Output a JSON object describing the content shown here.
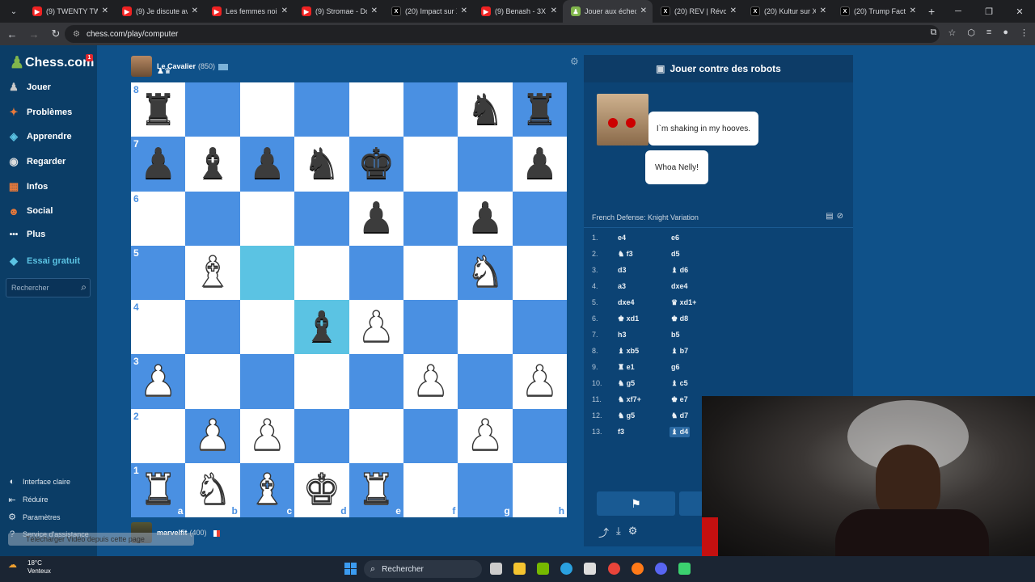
{
  "browser": {
    "tabs": [
      {
        "title": "(9) TWENTY TWE",
        "icon": "youtube-icon"
      },
      {
        "title": "(9) Je discute ave",
        "icon": "youtube-icon"
      },
      {
        "title": "Les femmes noire",
        "icon": "youtube-icon"
      },
      {
        "title": "(9) Stromae - Dou",
        "icon": "youtube-icon"
      },
      {
        "title": "(20) Impact sur X",
        "icon": "x-icon"
      },
      {
        "title": "(9) Benash - 3X D",
        "icon": "youtube-icon"
      },
      {
        "title": "Jouer aux échecs",
        "icon": "chesscom-icon",
        "active": true
      },
      {
        "title": "(20) REV | Révolut",
        "icon": "x-icon"
      },
      {
        "title": "(20) Kultur sur X",
        "icon": "x-icon"
      },
      {
        "title": "(20) Trump Fact N",
        "icon": "x-icon"
      }
    ],
    "url": "chess.com/play/computer"
  },
  "sidebar": {
    "logo": "Chess.com",
    "badge": "1",
    "items": [
      {
        "label": "Jouer",
        "icon": "play-icon"
      },
      {
        "label": "Problèmes",
        "icon": "puzzle-icon"
      },
      {
        "label": "Apprendre",
        "icon": "learn-icon"
      },
      {
        "label": "Regarder",
        "icon": "watch-icon"
      },
      {
        "label": "Infos",
        "icon": "news-icon"
      },
      {
        "label": "Social",
        "icon": "social-icon"
      },
      {
        "label": "Plus",
        "icon": "more-icon"
      },
      {
        "label": "Essai gratuit",
        "icon": "diamond-icon",
        "accent": "#5bc3e3"
      }
    ],
    "search_placeholder": "Rechercher",
    "footer": [
      {
        "label": "Interface claire",
        "icon": "contrast-icon"
      },
      {
        "label": "Réduire",
        "icon": "collapse-icon"
      },
      {
        "label": "Paramètres",
        "icon": "settings-icon"
      },
      {
        "label": "Service d'assistance",
        "icon": "help-icon"
      }
    ]
  },
  "opponent": {
    "name": "Le Cavalier",
    "rating": "(850)"
  },
  "player": {
    "name": "marvelfit",
    "rating": "(400)"
  },
  "download_popup": "Télécharger Vidéo depuis cette page",
  "board": {
    "light_color": "#ffffff",
    "dark_color": "#4a90e2",
    "highlight_color": "#5bc3e3",
    "ranks": [
      "8",
      "7",
      "6",
      "5",
      "4",
      "3",
      "2",
      "1"
    ],
    "files": [
      "a",
      "b",
      "c",
      "d",
      "e",
      "f",
      "g",
      "h"
    ],
    "pieces": {
      "a8": "br",
      "g8": "bn",
      "h8": "br",
      "a7": "bp",
      "b7": "bb",
      "c7": "bp",
      "d7": "bn",
      "e7": "bk",
      "h7": "bp",
      "e6": "bp",
      "g6": "bp",
      "b5": "wb",
      "g5": "wn",
      "d4": "bb",
      "e4": "wp",
      "a3": "wp",
      "f3": "wp",
      "h3": "wp",
      "b2": "wp",
      "c2": "wp",
      "g2": "wp",
      "a1": "wr",
      "b1": "wn",
      "c1": "wb",
      "d1": "wk",
      "e1": "wr"
    },
    "highlights": [
      "c5",
      "d4"
    ]
  },
  "panel": {
    "title": "Jouer contre des robots",
    "bubbles": [
      "I`m shaking in my hooves.",
      "Whoa Nelly!"
    ],
    "opening": "French Defense: Knight Variation",
    "moves": [
      {
        "n": "1.",
        "w": "e4",
        "b": "e6"
      },
      {
        "n": "2.",
        "w": "♞ f3",
        "b": "d5"
      },
      {
        "n": "3.",
        "w": "d3",
        "b": "♝ d6"
      },
      {
        "n": "4.",
        "w": "a3",
        "b": "dxe4"
      },
      {
        "n": "5.",
        "w": "dxe4",
        "b": "♛ xd1+"
      },
      {
        "n": "6.",
        "w": "♚ xd1",
        "b": "♚ d8"
      },
      {
        "n": "7.",
        "w": "h3",
        "b": "b5"
      },
      {
        "n": "8.",
        "w": "♝ xb5",
        "b": "♝ b7"
      },
      {
        "n": "9.",
        "w": "♜ e1",
        "b": "g6"
      },
      {
        "n": "10.",
        "w": "♞ g5",
        "b": "♝ c5"
      },
      {
        "n": "11.",
        "w": "♞ xf7+",
        "b": "♚ e7"
      },
      {
        "n": "12.",
        "w": "♞ g5",
        "b": "♞ d7"
      },
      {
        "n": "13.",
        "w": "f3",
        "b": "♝ d4"
      }
    ],
    "resign_icon": "flag-icon"
  },
  "taskbar": {
    "weather_temp": "18°C",
    "weather_desc": "Venteux",
    "search": "Rechercher"
  }
}
